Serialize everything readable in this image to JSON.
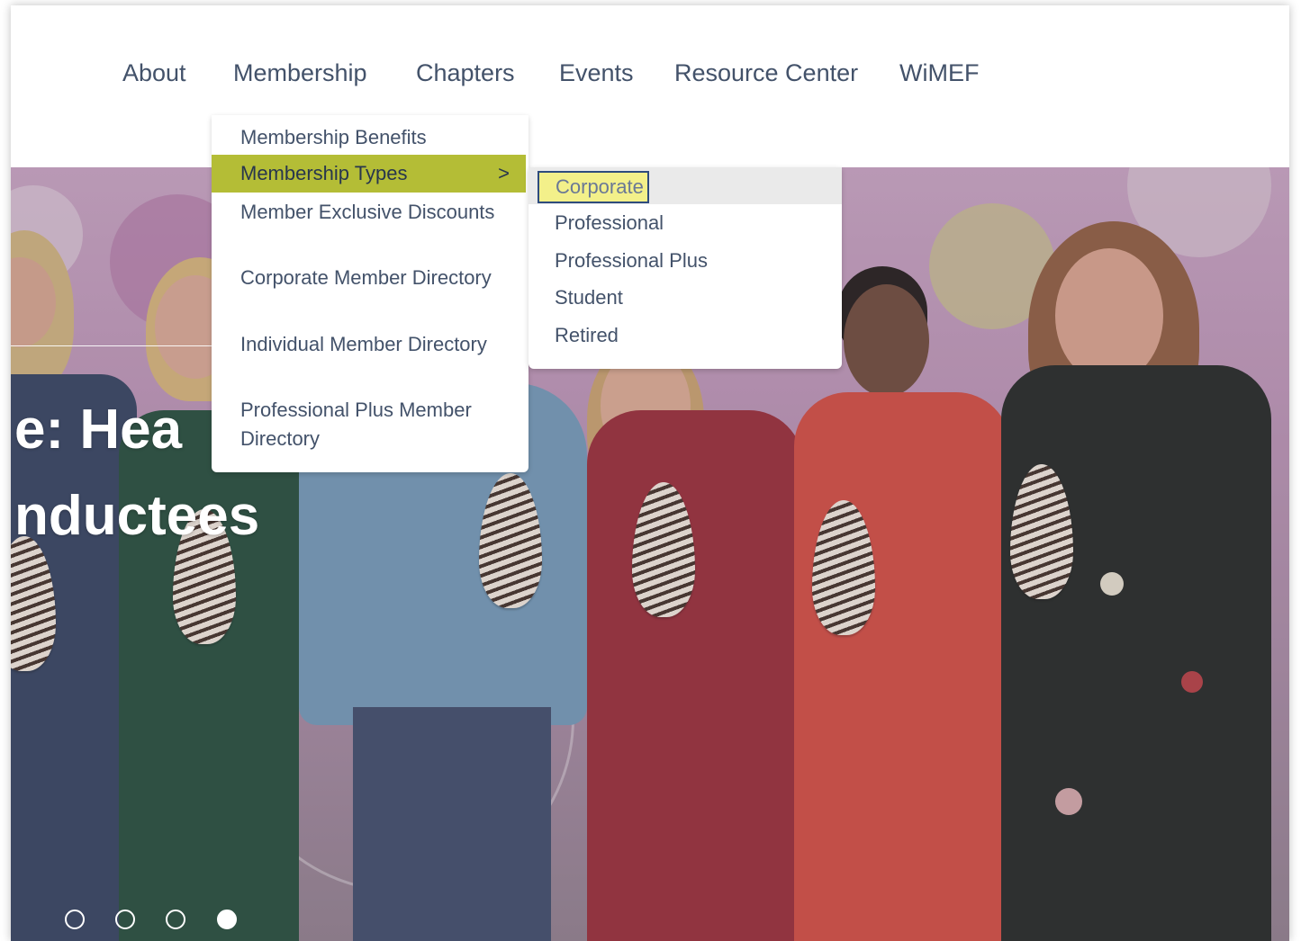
{
  "nav": {
    "items": [
      {
        "label": "About"
      },
      {
        "label": "Membership"
      },
      {
        "label": "Chapters"
      },
      {
        "label": "Events"
      },
      {
        "label": "Resource Center"
      },
      {
        "label": "WiMEF"
      }
    ]
  },
  "membership_menu": {
    "items": [
      {
        "label": "Membership Benefits"
      },
      {
        "label": "Membership Types",
        "chevron": ">"
      },
      {
        "label": "Member Exclusive Discounts"
      },
      {
        "label": "Corporate Member Directory"
      },
      {
        "label": "Individual Member Directory"
      },
      {
        "label": "Professional Plus Member Directory"
      }
    ]
  },
  "types_menu": {
    "items": [
      {
        "label": "Corporate"
      },
      {
        "label": "Professional"
      },
      {
        "label": "Professional Plus"
      },
      {
        "label": "Student"
      },
      {
        "label": "Retired"
      }
    ]
  },
  "hero": {
    "title_line1": "e: Hea",
    "title_line2": "nductees",
    "slides_total": 4,
    "active_slide": 4
  },
  "colors": {
    "accent": "#b4bd36",
    "nav_text": "#43526a",
    "focus_highlight": "#f3f08a",
    "focus_border": "#2e4b7d"
  }
}
